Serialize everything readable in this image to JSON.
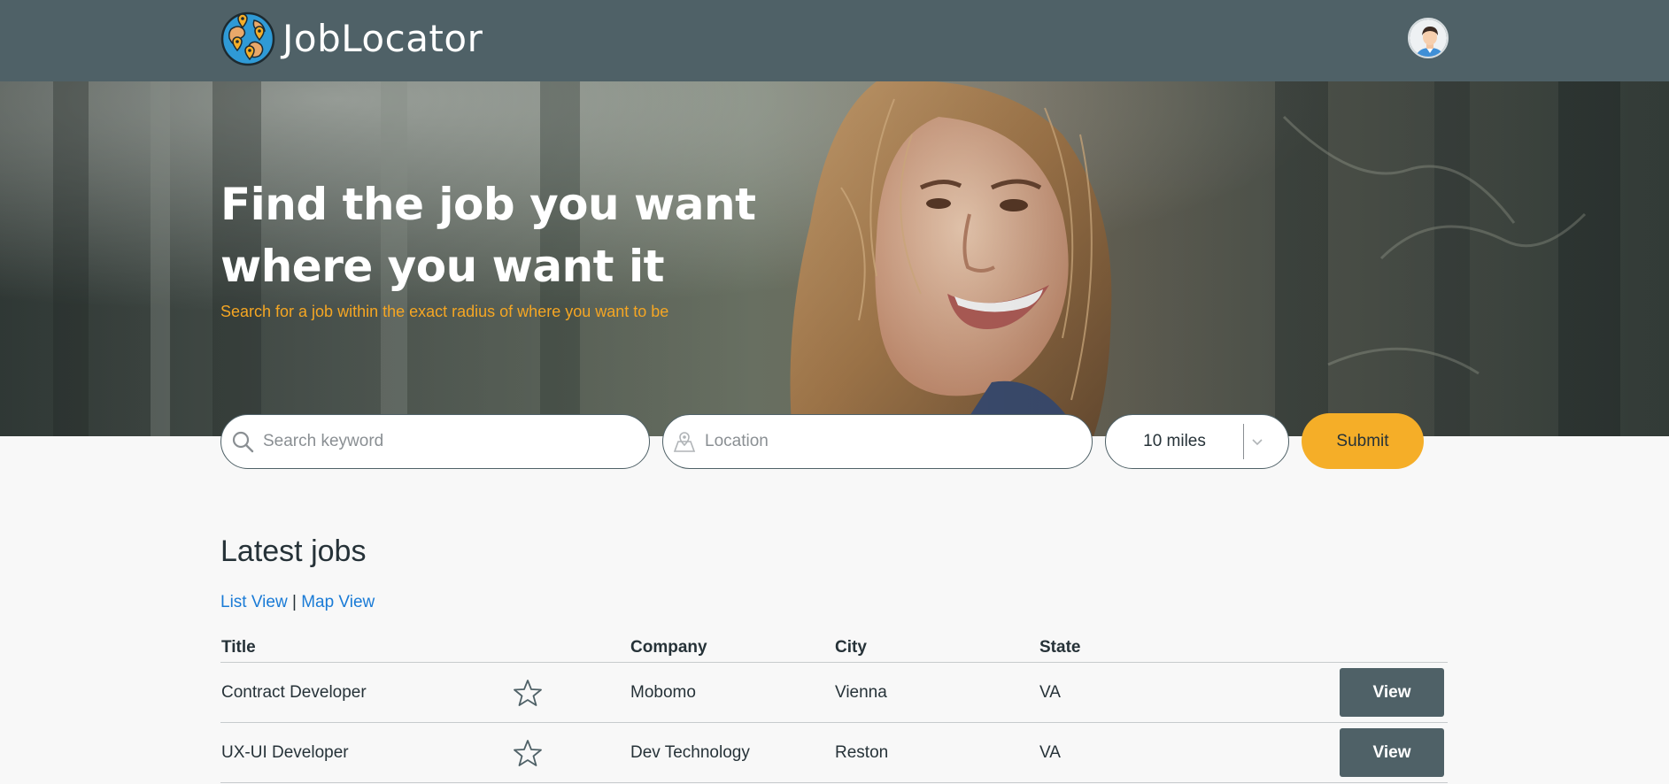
{
  "header": {
    "brand": "JobLocator",
    "logo_icon": "globe-map-pins-icon",
    "avatar_icon": "user-avatar-icon"
  },
  "hero": {
    "title": "Find the job you want where you want it",
    "subtitle": "Search for a job within the exact radius of where you want to be"
  },
  "search": {
    "keyword_placeholder": "Search keyword",
    "keyword_value": "",
    "location_placeholder": "Location",
    "location_value": "",
    "radius_value": "10 miles",
    "submit_label": "Submit"
  },
  "jobs": {
    "title": "Latest jobs",
    "list_view_label": "List View",
    "separator": "|",
    "map_view_label": "Map View",
    "columns": [
      "Title",
      "Company",
      "City",
      "State"
    ],
    "rows": [
      {
        "title": "Contract Developer",
        "company": "Mobomo",
        "city": "Vienna",
        "state": "VA",
        "action": "View"
      },
      {
        "title": "UX-UI Developer",
        "company": "Dev Technology",
        "city": "Reston",
        "state": "VA",
        "action": "View"
      }
    ]
  },
  "colors": {
    "header_bg": "#4f6167",
    "accent": "#f5ae28",
    "link": "#1a7bd6",
    "subtitle": "#f5a623"
  }
}
